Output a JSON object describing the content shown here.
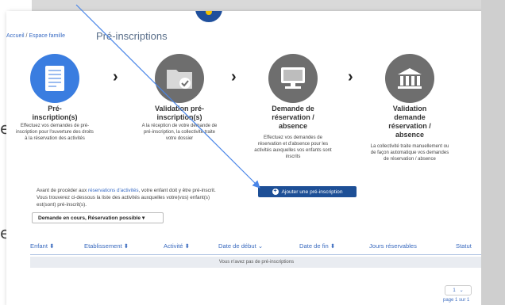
{
  "slide_fragments": {
    "frag1": "es",
    "frag2": "e,"
  },
  "breadcrumb": {
    "home": "Accueil",
    "separator": "/",
    "section": "Espace famille"
  },
  "page_title": "Pré-inscriptions",
  "steps": [
    {
      "icon": "document-icon",
      "title": "Pré-\ninscription(s)",
      "desc": "Effectuez vos demandes de pré-inscription pour l'ouverture des droits à la réservation des activités",
      "color": "#3a7de0"
    },
    {
      "icon": "folder-check-icon",
      "title": "Validation pré-\ninscription(s)",
      "desc": "A la réception de votre demande de pré-inscription, la collectivité traite votre dossier",
      "color": "#6e6e6e"
    },
    {
      "icon": "computer-icon",
      "title": "Demande de\nréservation /\nabsence",
      "desc": "Effectuez vos demandes de réservation et d'absence pour les activités auxquelles vos enfants sont inscrits",
      "color": "#6e6e6e"
    },
    {
      "icon": "bank-building-icon",
      "title": "Validation\ndemande\nréservation /\nabsence",
      "desc": "La collectivité traite manuellement ou de façon automatique vos demandes de réservation / absence",
      "color": "#6e6e6e"
    }
  ],
  "chevron": "›",
  "info": {
    "line1_a": "Avant de procéder aux ",
    "line1_link": "réservations d'activités",
    "line1_b": ", votre enfant doit y être pré-inscrit.",
    "line2": "Vous trouverez ci-dessous la liste des activités auxquelles votre(vos) enfant(s)",
    "line3": "est(sont) pré-inscrit(s)."
  },
  "add_button": {
    "label": "Ajouter une pré-inscription",
    "icon": "plus-circle-icon"
  },
  "filter": {
    "value": "Demande en cours, Réservation possible",
    "caret": "▾"
  },
  "table": {
    "columns": [
      "Enfant ⬍",
      "Etablissement ⬍",
      "Activité ⬍",
      "Date de début ⌄",
      "Date de fin ⬍",
      "Jours réservables",
      "Statut"
    ],
    "empty_message": "Vous n'avez pas de pré-inscriptions"
  },
  "pager": {
    "page": "1",
    "caret": "⌄",
    "page_of": "page 1 sur 1"
  },
  "colors": {
    "accent": "#1d4f96",
    "link": "#3b6bbf",
    "active_step": "#3a7de0",
    "inactive_step": "#6e6e6e"
  }
}
